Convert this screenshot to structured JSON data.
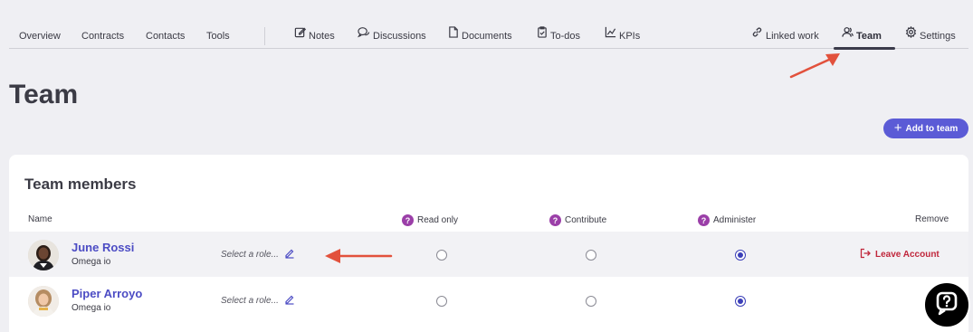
{
  "nav": {
    "items": [
      {
        "label": "Overview"
      },
      {
        "label": "Contracts"
      },
      {
        "label": "Contacts"
      },
      {
        "label": "Tools"
      },
      {
        "label": "Notes",
        "icon": "edit-icon"
      },
      {
        "label": "Discussions",
        "icon": "chat-bubbles-icon"
      },
      {
        "label": "Documents",
        "icon": "document-icon"
      },
      {
        "label": "To-dos",
        "icon": "clipboard-check-icon"
      },
      {
        "label": "KPIs",
        "icon": "chart-icon"
      },
      {
        "label": "Linked work",
        "icon": "link-icon"
      },
      {
        "label": "Team",
        "icon": "users-icon",
        "active": true
      },
      {
        "label": "Settings",
        "icon": "gear-icon"
      }
    ]
  },
  "page": {
    "title": "Team",
    "add_button": "Add to team"
  },
  "team": {
    "card_title": "Team members",
    "columns": {
      "name": "Name",
      "read_only": "Read only",
      "contribute": "Contribute",
      "administer": "Administer",
      "remove": "Remove"
    },
    "members": [
      {
        "name": "June Rossi",
        "org": "Omega io",
        "role_placeholder": "Select a role...",
        "permission": "Administer",
        "remove_label": "Leave Account"
      },
      {
        "name": "Piper Arroyo",
        "org": "Omega io",
        "role_placeholder": "Select a role...",
        "permission": "Administer",
        "remove_label": ""
      }
    ]
  },
  "colors": {
    "accent": "#5b5bd6",
    "member_name": "#4c4cc4",
    "help_icon": "#9b3fa8",
    "danger": "#c0263b",
    "annotation_arrow": "#e2513c"
  }
}
